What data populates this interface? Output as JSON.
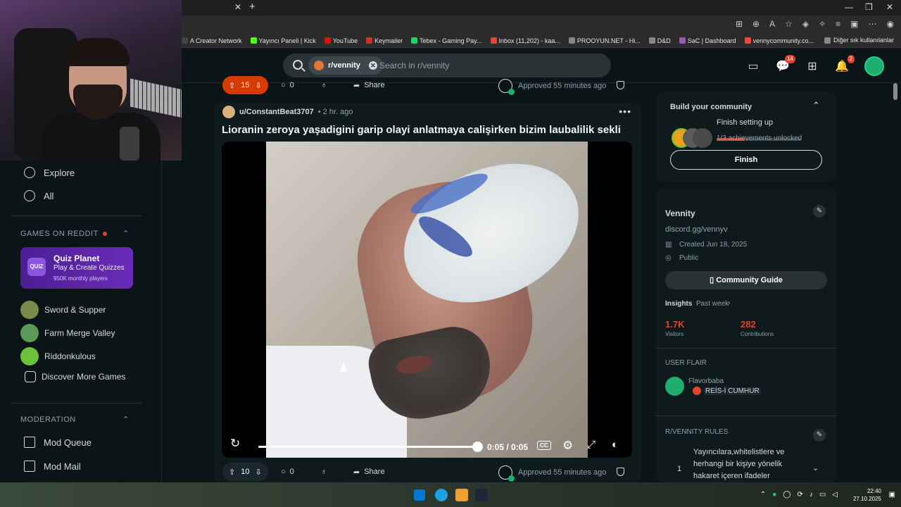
{
  "browser": {
    "new_tab": "+",
    "close_tab": "✕",
    "bookmarks": [
      {
        "label": "A Creator Network",
        "color": "#444"
      },
      {
        "label": "Yayıncı Paneli | Kick",
        "color": "#53fc18"
      },
      {
        "label": "YouTube",
        "color": "#ff0000"
      },
      {
        "label": "Keymailer",
        "color": "#c0392b"
      },
      {
        "label": "Tebex - Gaming Pay...",
        "color": "#2ecc71"
      },
      {
        "label": "Inbox (11,202) - kaa...",
        "color": "#ea4335"
      },
      {
        "label": "PROOYUN.NET - Hi...",
        "color": "#888"
      },
      {
        "label": "D&D",
        "color": "#888"
      },
      {
        "label": "SaC | Dashboard",
        "color": "#9b59b6"
      },
      {
        "label": "vennycommunity.co...",
        "color": "#e74c3c"
      }
    ],
    "bookmarks_other": "Diğer sık kullanılanlar"
  },
  "header": {
    "community_chip": "r/vennity",
    "search_placeholder": "Search in r/vennity",
    "chat_badge": "14",
    "notif_badge": "2"
  },
  "sidebar": {
    "nav": [
      {
        "label": "Explore",
        "icon": "explore-icon"
      },
      {
        "label": "All",
        "icon": "all-icon"
      }
    ],
    "games_title": "GAMES ON REDDIT",
    "quiz": {
      "logo": "QUIZ",
      "title": "Quiz Planet",
      "subtitle": "Play & Create Quizzes",
      "players": "950K monthly players"
    },
    "games": [
      {
        "label": "Sword & Supper",
        "color": "#7a8a4a"
      },
      {
        "label": "Farm Merge Valley",
        "color": "#5a9a5a"
      },
      {
        "label": "Riddonkulous",
        "color": "#6ac23a"
      },
      {
        "label": "Discover More Games",
        "color": ""
      }
    ],
    "moderation_title": "MODERATION",
    "moderation": [
      {
        "label": "Mod Queue"
      },
      {
        "label": "Mod Mail"
      }
    ]
  },
  "prev_post": {
    "votes": "15",
    "comments": "0",
    "share": "Share",
    "approved": "Approved 55 minutes ago"
  },
  "post": {
    "author": "u/ConstantBeat3707",
    "time": "• 2 hr. ago",
    "title": "Lioranin zeroya yaşadigini garip olayi anlatmaya calişirken bizim laubalilik sekli",
    "video_time": "0:05 / 0:05",
    "video_progress": 1.0,
    "cc": "CC",
    "votes": "10",
    "comments": "0",
    "share": "Share",
    "approved": "Approved 55 minutes ago"
  },
  "right": {
    "build_title": "Build your community",
    "finish_setup": "Finish setting up",
    "achievements": "1/3 achievements unlocked",
    "achievement_progress": 0.33,
    "finish_btn": "Finish",
    "community_name": "Vennity",
    "discord": "discord.gg/vennyv",
    "created": "Created Jun 18, 2025",
    "visibility": "Public",
    "guide_btn": "Community Guide",
    "insights_label": "Insights",
    "insights_period": "Past week",
    "visitors_num": "1.7K",
    "visitors_label": "Visitors",
    "contrib_num": "282",
    "contrib_label": "Contributions",
    "flair_title": "USER FLAIR",
    "flair_user": "Flavorbaba",
    "flair_tag": "REİS-İ CUMHUR",
    "rules_title": "R/VENNITY RULES",
    "rule_num": "1",
    "rule_text": "Yayıncılara,whitelistlere ve herhangi bir kişiye yönelik hakaret içeren ifadeler"
  },
  "taskbar": {
    "time": "22:40",
    "date": "27.10.2025"
  }
}
